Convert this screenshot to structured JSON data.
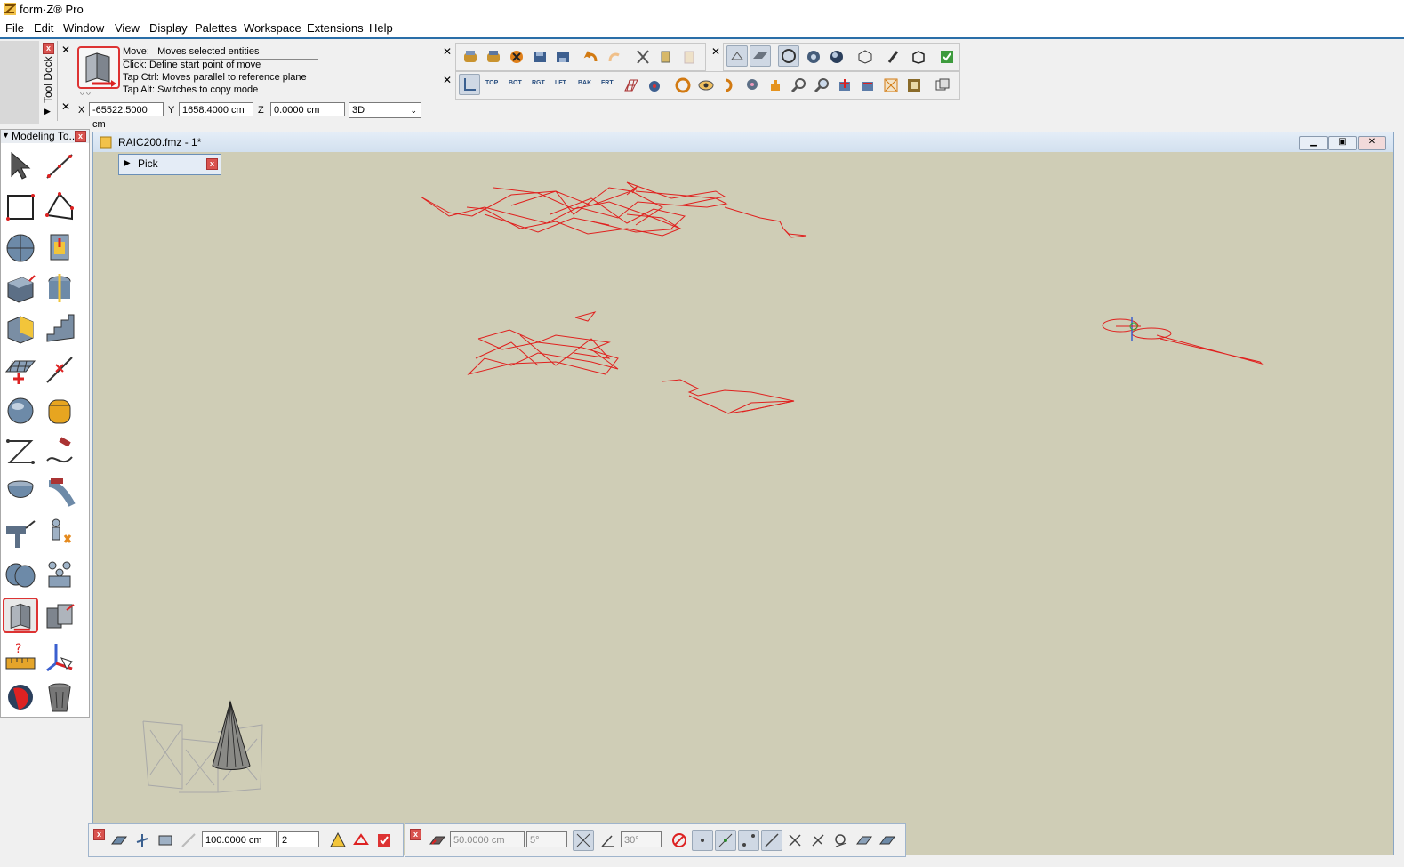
{
  "app": {
    "title": "form·Z® Pro"
  },
  "menu": [
    "File",
    "Edit",
    "Window",
    "View",
    "Display",
    "Palettes",
    "Workspace",
    "Extensions",
    "Help"
  ],
  "tool_dock": {
    "label": "Tool Dock"
  },
  "move_help": {
    "line1_label": "Move:",
    "line1_text": "Moves selected entities",
    "line2": "Click: Define start point of move",
    "line3": "Tap Ctrl: Moves parallel to reference plane",
    "line4": "Tap Alt: Switches to copy mode"
  },
  "coords": {
    "x_label": "X",
    "x_value": "-65522.5000 cm",
    "y_label": "Y",
    "y_value": "1658.4000 cm",
    "z_label": "Z",
    "z_value": "0.0000 cm",
    "view_mode": "3D"
  },
  "view_buttons": [
    "TOP",
    "BOT",
    "RGT",
    "LFT",
    "BAK",
    "FRT"
  ],
  "palette": {
    "title": "Modeling To..."
  },
  "document": {
    "title": "RAIC200.fmz - 1*",
    "pick_label": "Pick"
  },
  "bottom_bar1": {
    "grid_value": "100.0000 cm",
    "count_value": "2"
  },
  "bottom_bar2": {
    "snap_value": "50.0000 cm",
    "angle_value": "5°",
    "angle2_value": "30°"
  },
  "colors": {
    "accent": "#2a6ea8",
    "canvas": "#cfcdb6",
    "wire_red": "#e0201e"
  }
}
